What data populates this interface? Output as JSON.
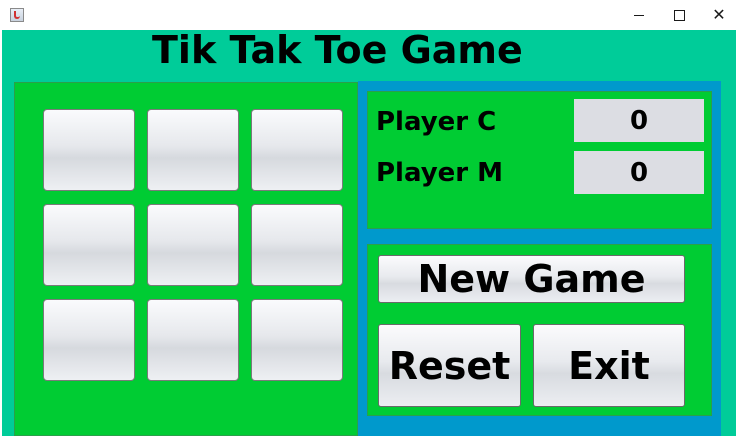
{
  "window": {
    "title": "",
    "controls": {
      "minimize": "–",
      "maximize": "☐",
      "close": "✕"
    }
  },
  "game": {
    "title": "Tik Tak Toe Game",
    "board": [
      "",
      "",
      "",
      "",
      "",
      "",
      "",
      "",
      ""
    ]
  },
  "scores": {
    "player_c_label": "Player C",
    "player_c_score": "0",
    "player_m_label": "Player M",
    "player_m_score": "0"
  },
  "controls": {
    "new_game_label": "New Game",
    "reset_label": "Reset",
    "exit_label": "Exit"
  },
  "colors": {
    "background": "#00cc99",
    "panel": "#00cc33",
    "frame": "#0099cc",
    "score_box": "#dcdde3"
  },
  "icons": {
    "app": "java-app-icon"
  }
}
